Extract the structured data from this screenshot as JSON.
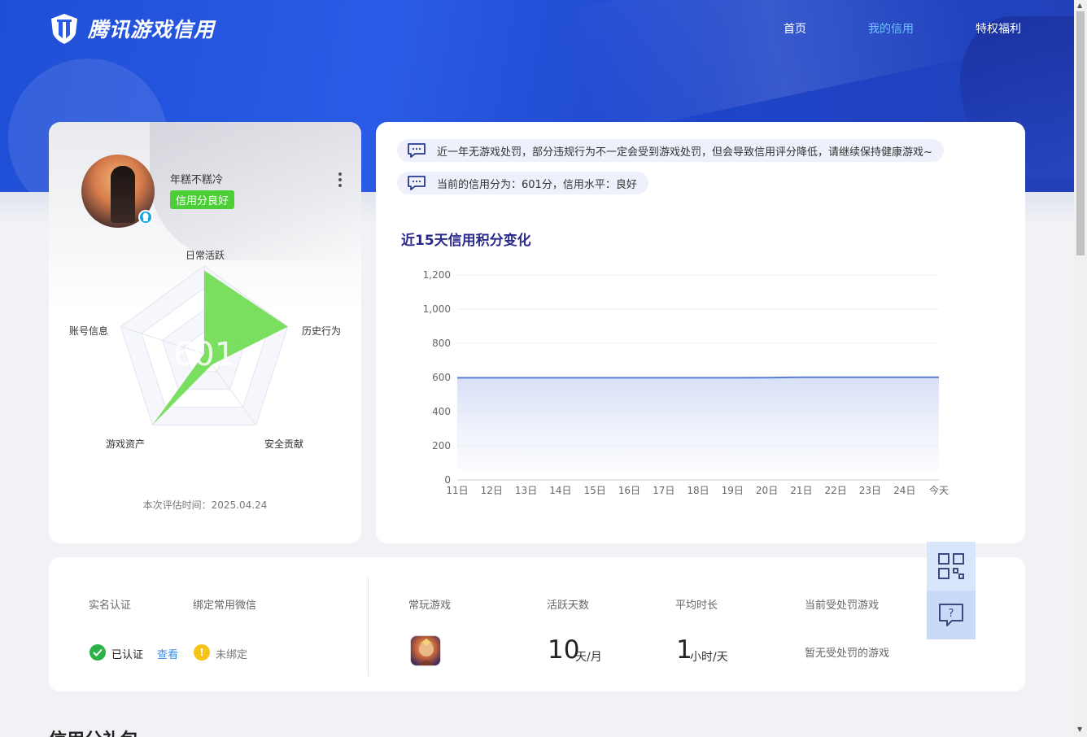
{
  "header": {
    "logo_text": "腾讯游戏信用",
    "nav": [
      {
        "label": "首页",
        "active": false
      },
      {
        "label": "我的信用",
        "active": true
      },
      {
        "label": "特权福利",
        "active": false
      }
    ]
  },
  "profile": {
    "username": "年糕不糕冷",
    "credit_badge": "信用分良好",
    "score": "601",
    "radar_labels": [
      "日常活跃",
      "历史行为",
      "安全贡献",
      "游戏资产",
      "账号信息"
    ],
    "radar_values": [
      0.95,
      1.0,
      0.15,
      1.0,
      0.0
    ],
    "eval_time": "本次评估时间：2025.04.24"
  },
  "notices": [
    "近一年无游戏处罚，部分违规行为不一定会受到游戏处罚，但会导致信用评分降低，请继续保持健康游戏~",
    "当前的信用分为：601分，信用水平：良好"
  ],
  "chart": {
    "title": "近15天信用积分变化"
  },
  "chart_data": {
    "type": "area",
    "title": "近15天信用积分变化",
    "categories": [
      "11日",
      "12日",
      "13日",
      "14日",
      "15日",
      "16日",
      "17日",
      "18日",
      "19日",
      "20日",
      "21日",
      "22日",
      "23日",
      "24日",
      "今天"
    ],
    "values": [
      598,
      598,
      598,
      598,
      598,
      598,
      598,
      598,
      598,
      599,
      601,
      601,
      601,
      601,
      601
    ],
    "ylim": [
      0,
      1200
    ],
    "yticks": [
      "0",
      "200",
      "400",
      "600",
      "800",
      "1,000",
      "1,200"
    ],
    "grid": true,
    "color": "#5b7fd6"
  },
  "stats": {
    "realname_label": "实名认证",
    "wechat_label": "绑定常用微信",
    "realname_status": "已认证",
    "view_link": "查看",
    "wechat_status": "未绑定",
    "fav_game_label": "常玩游戏",
    "active_days_label": "活跃天数",
    "active_days_value": "10",
    "active_days_unit": "天/月",
    "avg_time_label": "平均时长",
    "avg_time_value": "1",
    "avg_time_unit": "小时/天",
    "punish_label": "当前受处罚游戏",
    "punish_value": "暂无受处罚的游戏"
  },
  "side_tools": {
    "icons": [
      "qrcode-icon",
      "help-icon"
    ]
  },
  "next_section_title": "信用分礼包"
}
